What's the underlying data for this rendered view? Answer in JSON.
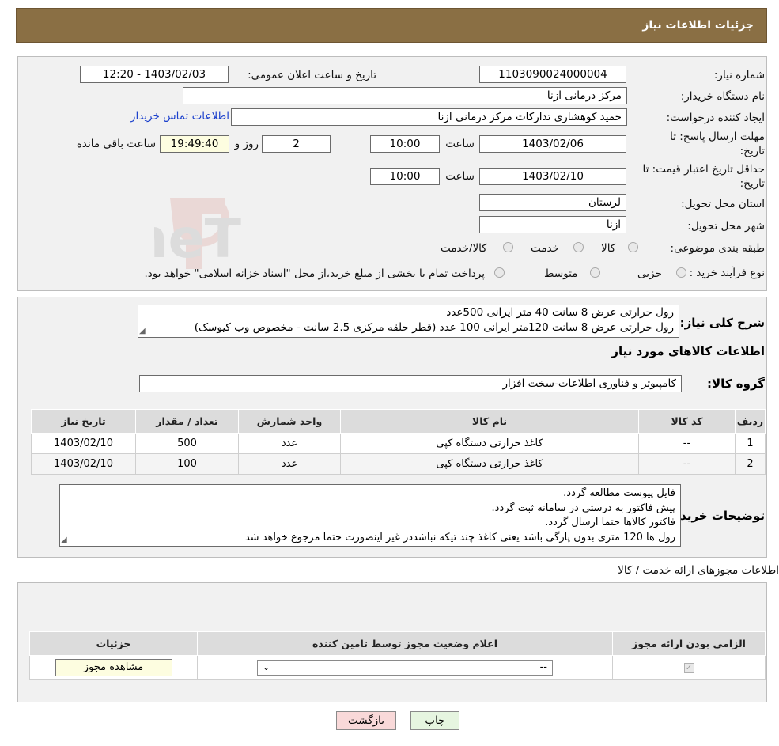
{
  "header": {
    "title": "جزئیات اطلاعات نیاز"
  },
  "form": {
    "need_number_label": "شماره نیاز:",
    "need_number": "1103090024000004",
    "announce_label": "تاریخ و ساعت اعلان عمومی:",
    "announce_value": "1403/02/03 - 12:20",
    "buyer_org_label": "نام دستگاه خریدار:",
    "buyer_org": "مرکز درمانی ازنا",
    "creator_label": "ایجاد کننده درخواست:",
    "creator": "حمید کوهشاری تداركات مرکز درمانی ازنا",
    "contact_link": "اطلاعات تماس خریدار",
    "deadline_label_1": "مهلت ارسال پاسخ: تا",
    "deadline_label_2": "تاریخ:",
    "deadline_date": "1403/02/06",
    "time_label": "ساعت",
    "deadline_time": "10:00",
    "days_value": "2",
    "days_label": "روز و",
    "remaining_time": "19:49:40",
    "remaining_label": "ساعت باقی مانده",
    "validity_label_1": "حداقل تاریخ اعتبار قیمت: تا",
    "validity_label_2": "تاریخ:",
    "validity_date": "1403/02/10",
    "validity_time": "10:00",
    "province_label": "استان محل تحویل:",
    "province": "لرستان",
    "city_label": "شهر محل تحویل:",
    "city": "ازنا",
    "category_label": "طبقه بندی موضوعی:",
    "category_options": [
      "کالا",
      "خدمت",
      "کالا/خدمت"
    ],
    "process_label": "نوع فرآیند خرید :",
    "process_options": [
      "جزیی",
      "متوسط"
    ],
    "process_note": "پرداخت تمام یا بخشی از مبلغ خرید،از محل \"اسناد خزانه اسلامی\" خواهد بود."
  },
  "description": {
    "label": "شرح کلی نیاز:",
    "line1": "رول حرارتی عرض 8 سانت  40 متر ایرانی    500عدد",
    "line2": "رول حرارتی عرض 8 سانت 120متر ایرانی  100 عدد (قطر حلقه مرکزی 2.5 سانت - مخصوص وب کیوسک)"
  },
  "goods": {
    "section_title": "اطلاعات کالاهای مورد نیاز",
    "group_label": "گروه کالا:",
    "group_value": "کامپیوتر و فناوری اطلاعات-سخت افزار",
    "columns": [
      "ردیف",
      "کد کالا",
      "نام کالا",
      "واحد شمارش",
      "تعداد / مقدار",
      "تاریخ نیاز"
    ],
    "rows": [
      [
        "1",
        "--",
        "کاغذ حرارتی دستگاه کپی",
        "عدد",
        "500",
        "1403/02/10"
      ],
      [
        "2",
        "--",
        "کاغذ حرارتی دستگاه کپی",
        "عدد",
        "100",
        "1403/02/10"
      ]
    ]
  },
  "buyer_notes": {
    "label": "توضیحات خریدار:",
    "lines": [
      "فایل پیوست مطالعه گردد.",
      "پیش فاکتور به درستی در سامانه ثبت گردد.",
      "فاکتور کالاها حتما ارسال گردد.",
      "رول ها 120 متری بدون پارگی باشد یعنی کاغذ چند تیکه نباشددر غیر اینصورت حتما مرجوع خواهد شد"
    ]
  },
  "permits": {
    "title": "اطلاعات مجوزهای ارائه خدمت / کالا",
    "columns": [
      "الزامی بودن ارائه مجوز",
      "اعلام وضعیت مجوز توسط تامین کننده",
      "جزئیات"
    ],
    "select_value": "--",
    "view_button": "مشاهده مجوز"
  },
  "buttons": {
    "print": "چاپ",
    "back": "بازگشت"
  },
  "watermark": {
    "text": "AriaTender.neT"
  },
  "colors": {
    "header": "#8a6f44",
    "panel": "#f1f1f1",
    "link": "#1a3fcc",
    "back_button": "#f9d9d9",
    "print_button": "#e6f5e0"
  }
}
